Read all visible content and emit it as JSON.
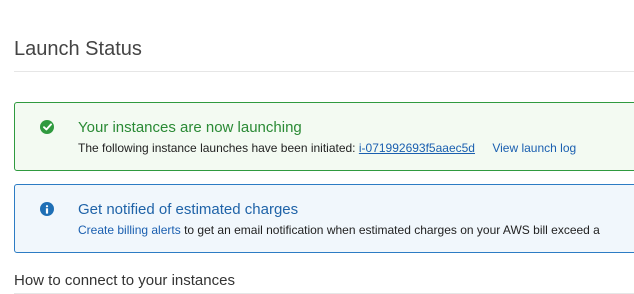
{
  "page": {
    "title": "Launch Status"
  },
  "success_alert": {
    "heading": "Your instances are now launching",
    "body_text": "The following instance launches have been initiated:",
    "instance_id": "i-071992693f5aaec5d",
    "log_link": "View launch log",
    "icon": "check-circle-icon",
    "color": "#2f9a3f"
  },
  "info_alert": {
    "heading": "Get notified of estimated charges",
    "link_text": "Create billing alerts",
    "body_text": "to get an email notification when estimated charges on your AWS bill exceed a",
    "icon": "info-circle-icon",
    "color": "#1f6fb5"
  },
  "connect_section": {
    "heading": "How to connect to your instances"
  }
}
